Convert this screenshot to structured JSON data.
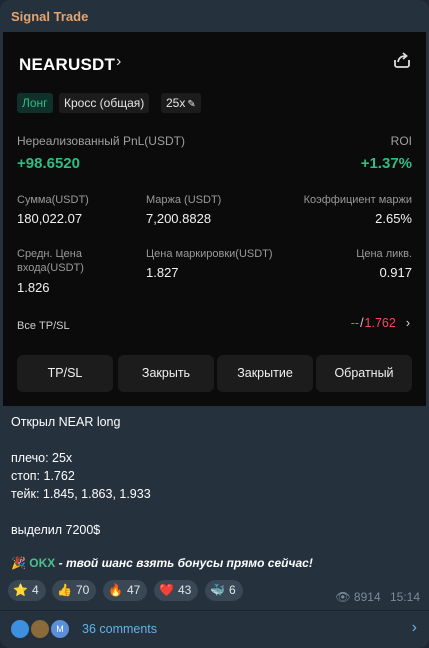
{
  "channel": {
    "name": "Signal Trade"
  },
  "position": {
    "pair": "NEARUSDT",
    "tags": {
      "side": "Лонг",
      "margin_mode": "Кросс (общая)",
      "leverage": "25x"
    },
    "pnl_label": "Нереализованный PnL(USDT)",
    "pnl_value": "+98.6520",
    "roi_label": "ROI",
    "roi_value": "+1.37%",
    "size_label": "Сумма(USDT)",
    "size_value": "180,022.07",
    "margin_label": "Маржа (USDT)",
    "margin_value": "7,200.8828",
    "ratio_label": "Коэффициент маржи",
    "ratio_value": "2.65%",
    "entry_label_1": "Средн. Цена",
    "entry_label_2": "входа(USDT)",
    "entry_value": "1.826",
    "mark_label": "Цена маркировки(USDT)",
    "mark_value": "1.827",
    "liq_label": "Цена ликв.",
    "liq_value": "0.917",
    "tpsl_label": "Все TP/SL",
    "tp_value": "--",
    "sl_separator": "/",
    "sl_value": "1.762",
    "buttons": {
      "tpsl": "TP/SL",
      "close": "Закрыть",
      "closing": "Закрытие",
      "reverse": "Обратный"
    }
  },
  "message": {
    "line1": "Открыл NEAR long",
    "line2": "плечо: 25x",
    "line3": "стоп: 1.762",
    "line4": "тейк: 1.845, 1.863, 1.933",
    "line5": "выделил 7200$",
    "promo_brand": "OKX",
    "promo_text": " - твой шанс взять бонусы прямо сейчас!"
  },
  "reactions": [
    {
      "emoji": "⭐",
      "count": "4"
    },
    {
      "emoji": "👍",
      "count": "70"
    },
    {
      "emoji": "🔥",
      "count": "47"
    },
    {
      "emoji": "❤️",
      "count": "43"
    },
    {
      "emoji": "🐳",
      "count": "6"
    }
  ],
  "meta": {
    "views": "8914",
    "time": "15:14"
  },
  "comments": {
    "label": "36 comments",
    "avatar_letter": "M"
  },
  "colors": {
    "accent_green": "#2ebd85",
    "accent_red": "#f6465d",
    "link_blue": "#5fb5ec",
    "channel_orange": "#e8a36c"
  }
}
